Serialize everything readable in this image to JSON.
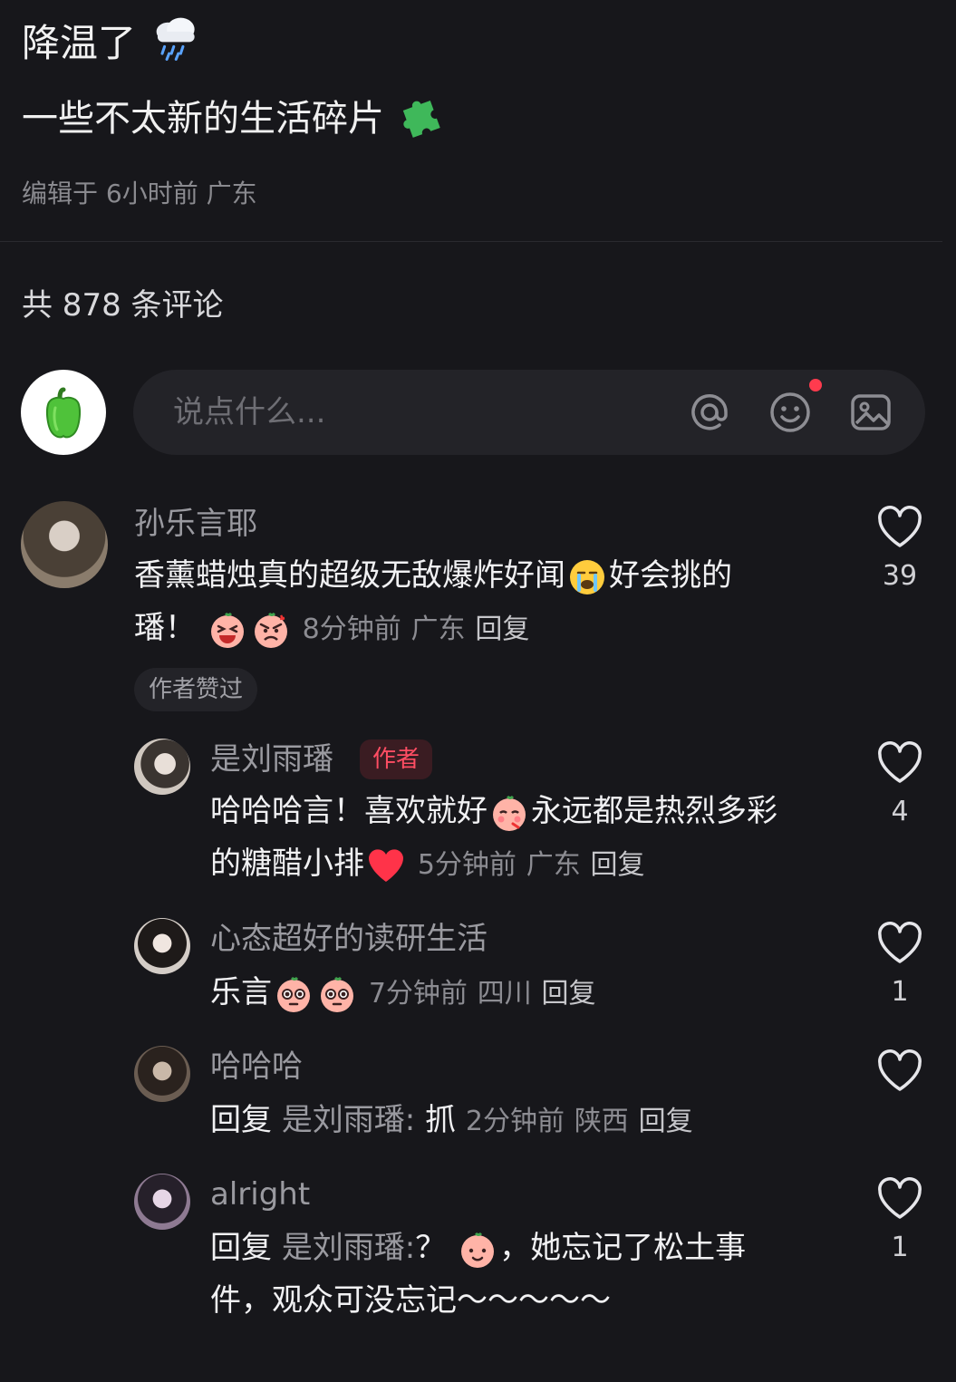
{
  "post": {
    "title": "降温了",
    "title_emoji": "cloud-rain-icon",
    "subtitle": "一些不太新的生活碎片",
    "subtitle_emoji": "puzzle-icon",
    "meta": "编辑于 6小时前 广东"
  },
  "comments_header": {
    "count_text": "共 878 条评论"
  },
  "composer": {
    "placeholder": "说点什么..."
  },
  "comments": [
    {
      "user": "孙乐言耶",
      "text_a": "香薰蜡烛真的超级无敌爆炸好闻",
      "text_b": "好会挑的",
      "text_c": "璠！",
      "time": "8分钟前",
      "location": "广东",
      "reply_label": "回复",
      "likes": "39",
      "badge": "作者赞过"
    },
    {
      "user": "是刘雨璠",
      "author_tag": "作者",
      "text_a": "哈哈哈言！喜欢就好",
      "text_b": "永远都是热烈多彩",
      "text_c": "的糖醋小排",
      "time": "5分钟前",
      "location": "广东",
      "reply_label": "回复",
      "likes": "4"
    },
    {
      "user": "心态超好的读研生活",
      "text_a": "乐言",
      "time": "7分钟前",
      "location": "四川",
      "reply_label": "回复",
      "likes": "1"
    },
    {
      "user": "哈哈哈",
      "reply_prefix": "回复",
      "reply_target": "是刘雨璠:",
      "text_a": "抓",
      "time": "2分钟前",
      "location": "陕西",
      "reply_label": "回复",
      "likes": ""
    },
    {
      "user": "alright",
      "reply_prefix": "回复",
      "reply_target": "是刘雨璠:",
      "text_a": "？",
      "text_b": "，她忘记了松土事",
      "text_c": "件，观众可没忘记～～～～～",
      "likes": "1"
    }
  ],
  "colors": {
    "background": "#17171b",
    "accent": "#ff4d63",
    "muted": "#8a8a8f"
  }
}
